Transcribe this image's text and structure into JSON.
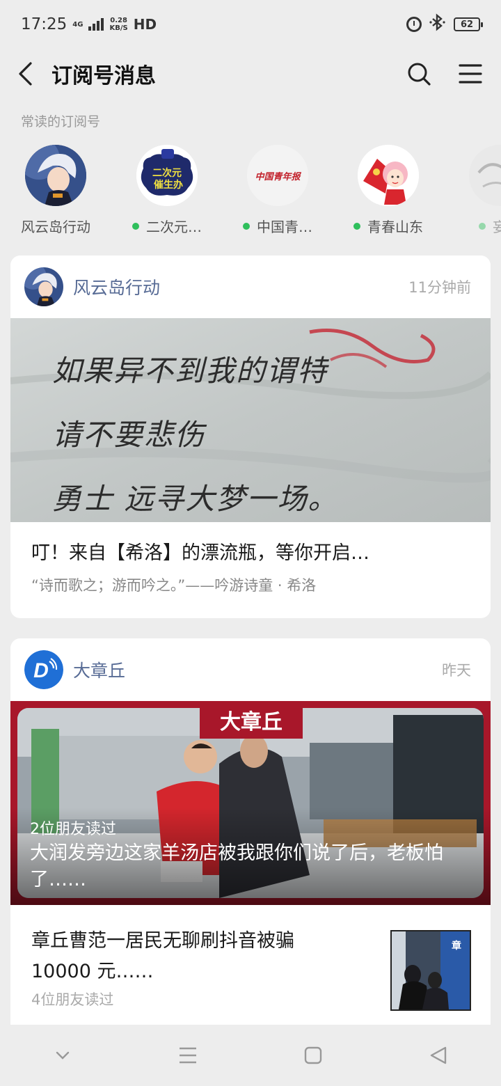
{
  "status_bar": {
    "time": "17:25",
    "network": "4G",
    "speed_top": "0.28",
    "speed_bottom": "KB/S",
    "hd": "HD",
    "battery": "62"
  },
  "header": {
    "title": "订阅号消息"
  },
  "frequent": {
    "label": "常读的订阅号",
    "items": [
      {
        "name": "风云岛行动",
        "dot": false
      },
      {
        "name": "二次元…",
        "dot": true
      },
      {
        "name": "中国青…",
        "dot": true
      },
      {
        "name": "青春山东",
        "dot": true
      },
      {
        "name": "妄想",
        "dot": true
      }
    ],
    "avatar_texts": {
      "erciyuan_line1": "二次元",
      "erciyuan_line2": "催生办",
      "qingnian": "中国青年报"
    }
  },
  "cards": [
    {
      "source": "风云岛行动",
      "time": "11分钟前",
      "cover_text_lines": [
        "如果异不到我的谓特",
        "请不要悲伤",
        "勇士 远寻大梦一场。"
      ],
      "title": "叮！来自【希洛】的漂流瓶，等你开启…",
      "summary": "“诗而歌之；游而吟之。”——吟游诗童 · 希洛"
    },
    {
      "source": "大章丘",
      "time": "昨天",
      "banner": "大章丘",
      "friends_read": "2位朋友读过",
      "cover_title": "大润发旁边这家羊汤店被我跟你们说了后，老板怕了……",
      "article2_title": "章丘曹范一居民无聊刷抖音被骗10000 元……",
      "article2_friends": "4位朋友读过",
      "thumb_text": "章"
    }
  ],
  "colors": {
    "background": "#ededed",
    "link": "#576b95",
    "green_dot": "#2fbf5c",
    "banner_red": "#a8172a"
  }
}
